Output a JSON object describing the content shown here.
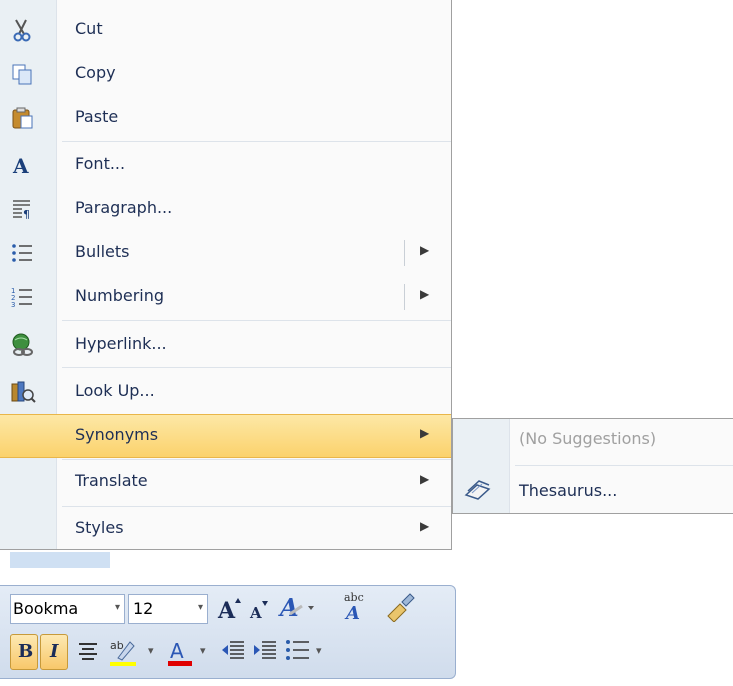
{
  "context_menu": {
    "items": [
      {
        "label": "Cut",
        "icon": "scissors-icon"
      },
      {
        "label": "Copy",
        "icon": "copy-icon"
      },
      {
        "label": "Paste",
        "icon": "paste-icon"
      },
      {
        "label": "Font...",
        "icon": "font-icon"
      },
      {
        "label": "Paragraph...",
        "icon": "paragraph-icon"
      },
      {
        "label": "Bullets",
        "icon": "bullets-icon",
        "arrow": "▶"
      },
      {
        "label": "Numbering",
        "icon": "numbering-icon",
        "arrow": "▶"
      },
      {
        "label": "Hyperlink...",
        "icon": "hyperlink-icon"
      },
      {
        "label": "Look Up...",
        "icon": "research-icon"
      },
      {
        "label": "Synonyms",
        "arrow": "▶",
        "highlighted": true
      },
      {
        "label": "Translate",
        "arrow": "▶"
      },
      {
        "label": "Styles",
        "arrow": "▶"
      }
    ]
  },
  "synonyms_submenu": {
    "no_suggestions": "(No Suggestions)",
    "thesaurus": "Thesaurus..."
  },
  "mini_toolbar": {
    "font_name": "Bookma",
    "font_size": "12",
    "bold": "B",
    "italic": "I",
    "dropdown_arrow": "▾"
  },
  "colors": {
    "highlight": "#fbd26c",
    "gutter": "#eaf0f4",
    "highlight_color_bar": "#ffff00",
    "font_color_bar": "#e00000"
  }
}
